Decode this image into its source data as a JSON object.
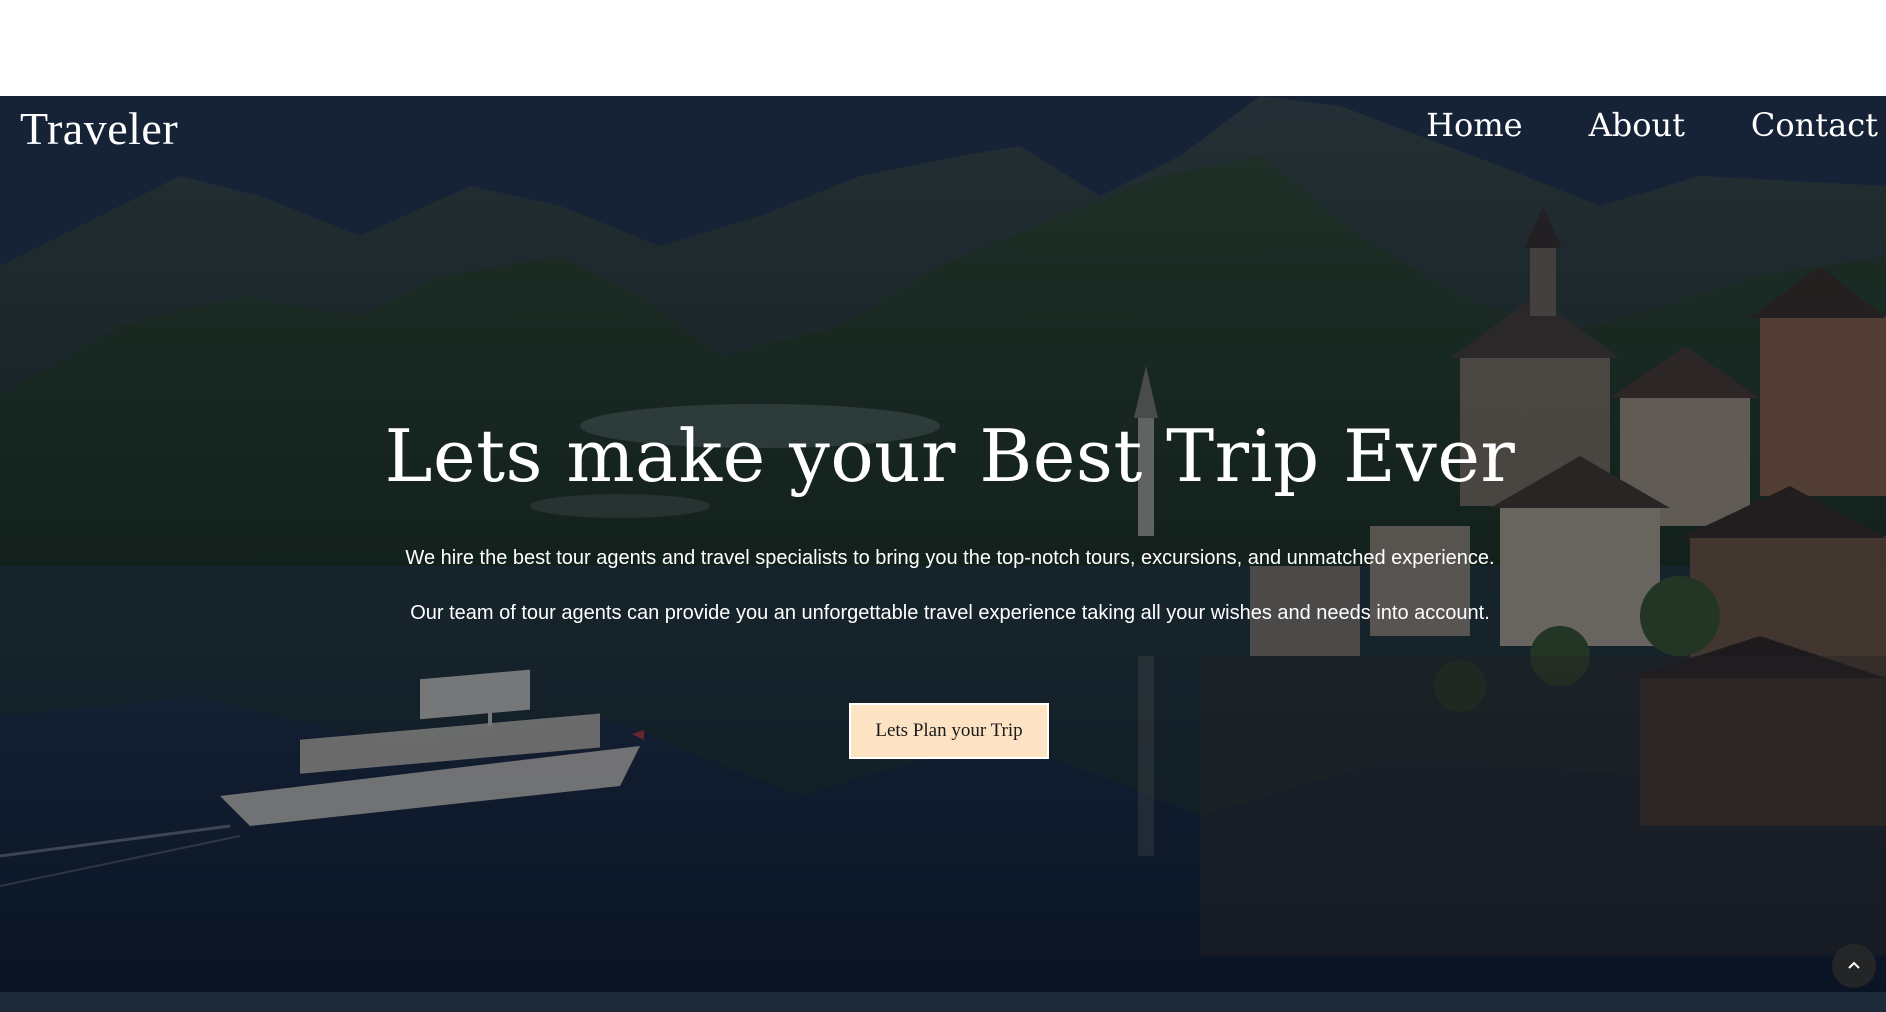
{
  "header": {
    "logo": "Traveler",
    "nav": [
      {
        "label": "Home"
      },
      {
        "label": "About"
      },
      {
        "label": "Contact"
      }
    ]
  },
  "hero": {
    "headline": "Lets make your Best Trip Ever",
    "paragraph_1": "We hire the best tour agents and travel specialists to bring you the top-notch tours, excursions, and unmatched experience.",
    "paragraph_2": "Our team of tour agents can provide you an unforgettable travel experience taking all your wishes and needs into account.",
    "cta_label": "Lets Plan your Trip"
  },
  "icons": {
    "scroll_top": "chevron-up-icon"
  },
  "colors": {
    "cta_background": "#fde3c4",
    "text": "#ffffff"
  }
}
